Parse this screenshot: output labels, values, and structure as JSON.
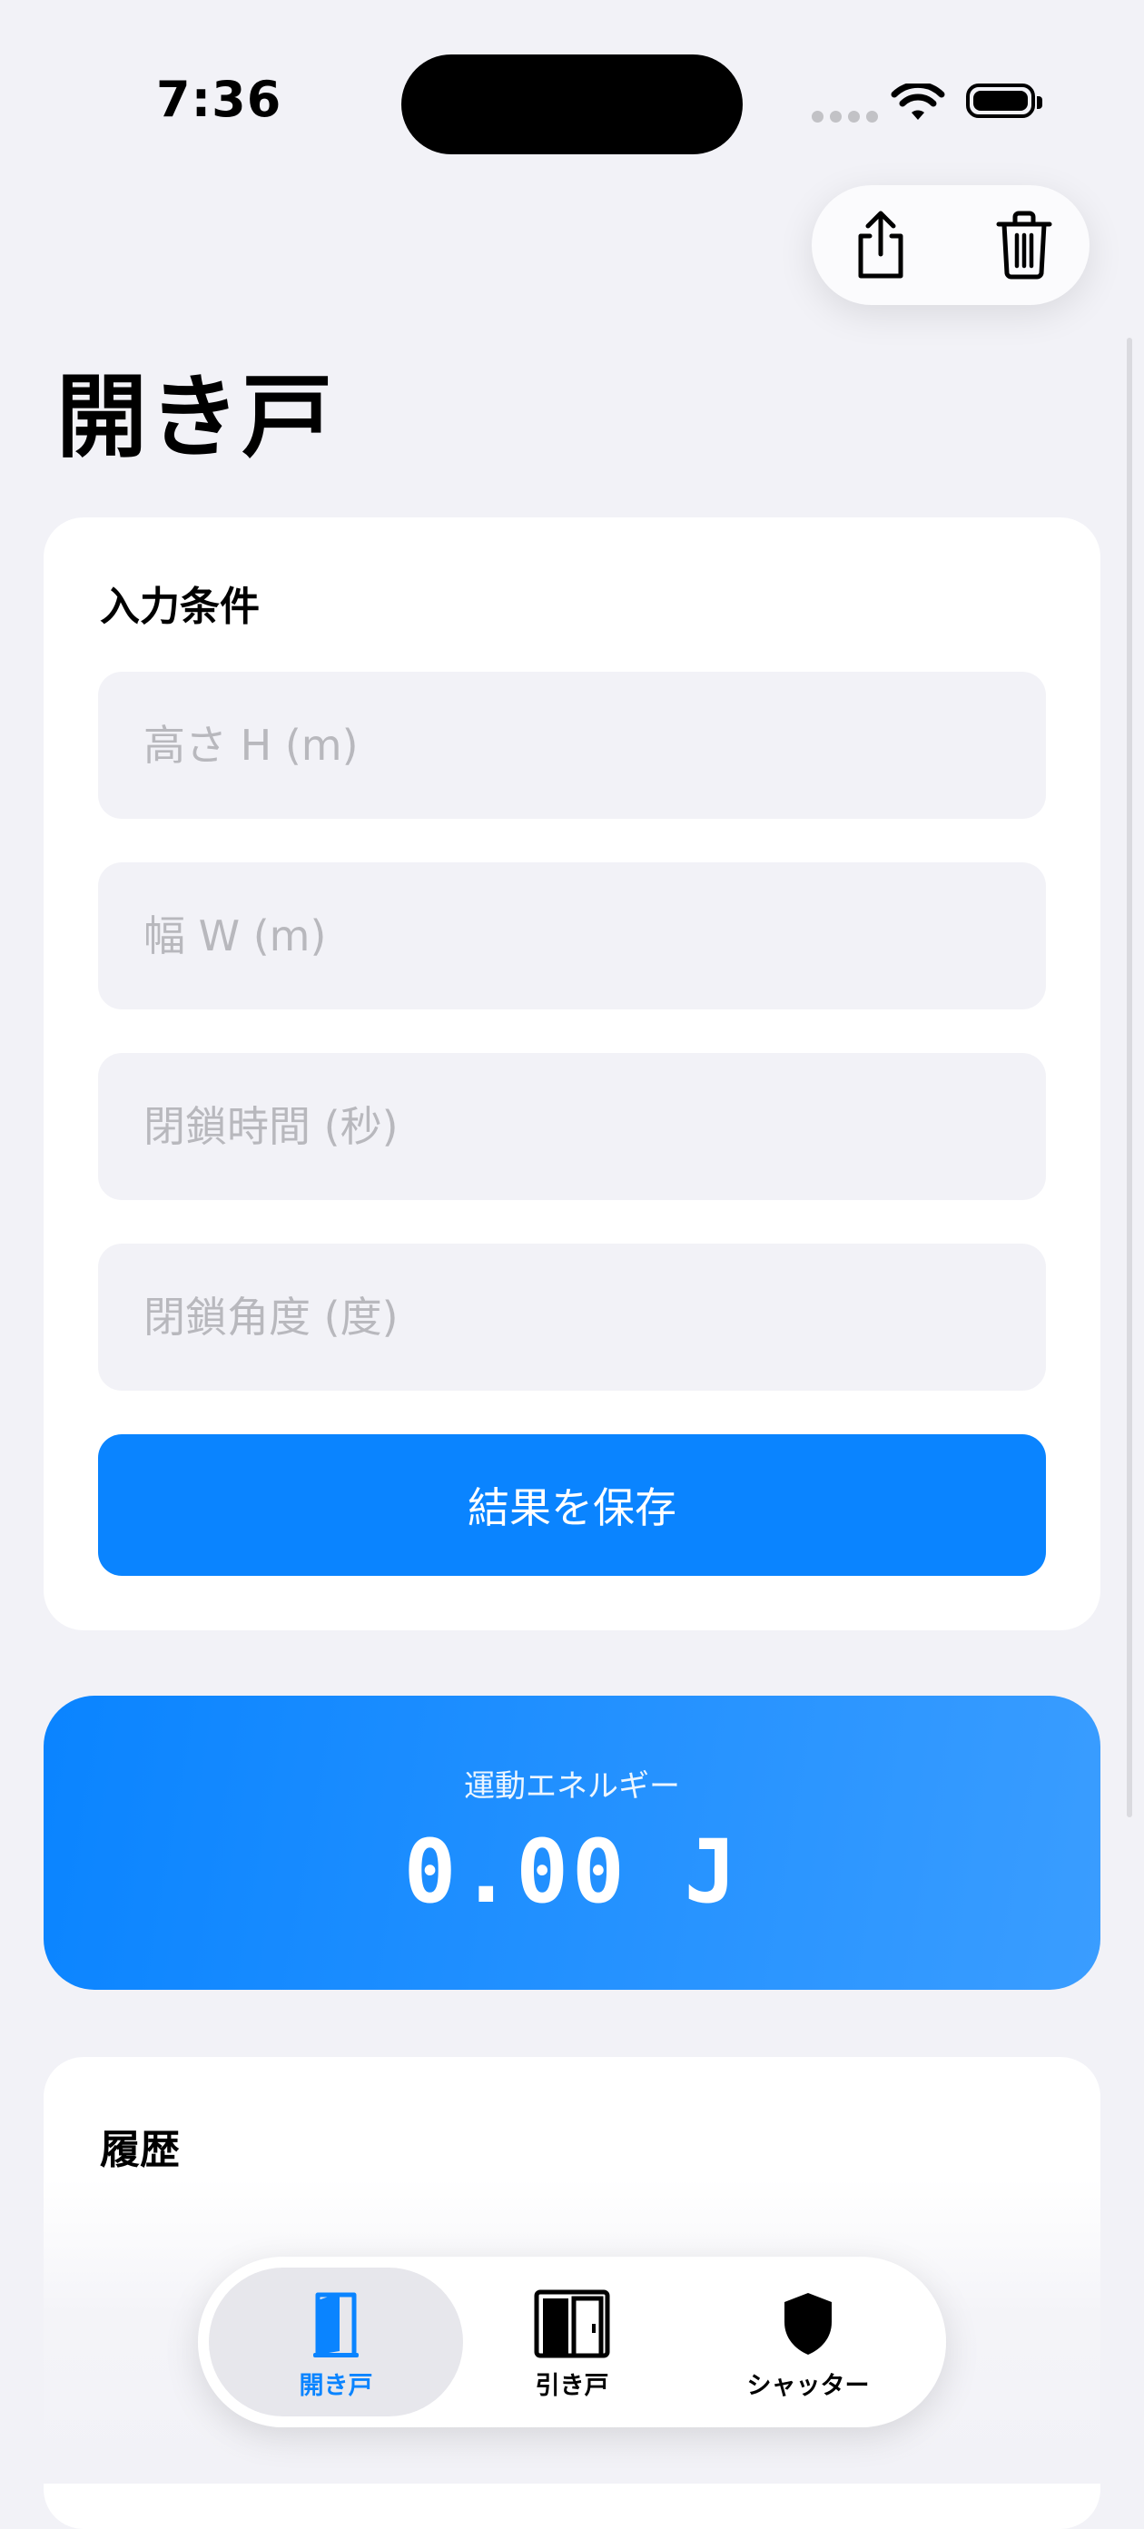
{
  "status_bar": {
    "time": "7:36"
  },
  "page": {
    "title": "開き戸"
  },
  "input_section": {
    "title": "入力条件",
    "fields": [
      {
        "placeholder": "高さ H (m)",
        "value": ""
      },
      {
        "placeholder": "幅 W (m)",
        "value": ""
      },
      {
        "placeholder": "閉鎖時間 (秒)",
        "value": ""
      },
      {
        "placeholder": "閉鎖角度 (度)",
        "value": ""
      }
    ],
    "save_label": "結果を保存"
  },
  "result": {
    "label": "運動エネルギー",
    "value": "0.00 J"
  },
  "history": {
    "title": "履歴"
  },
  "tabs": [
    {
      "label": "開き戸",
      "icon": "hinged-door-icon",
      "active": true
    },
    {
      "label": "引き戸",
      "icon": "sliding-door-icon",
      "active": false
    },
    {
      "label": "シャッター",
      "icon": "shield-icon",
      "active": false
    }
  ],
  "colors": {
    "accent": "#0a84ff",
    "background": "#f2f2f7"
  }
}
